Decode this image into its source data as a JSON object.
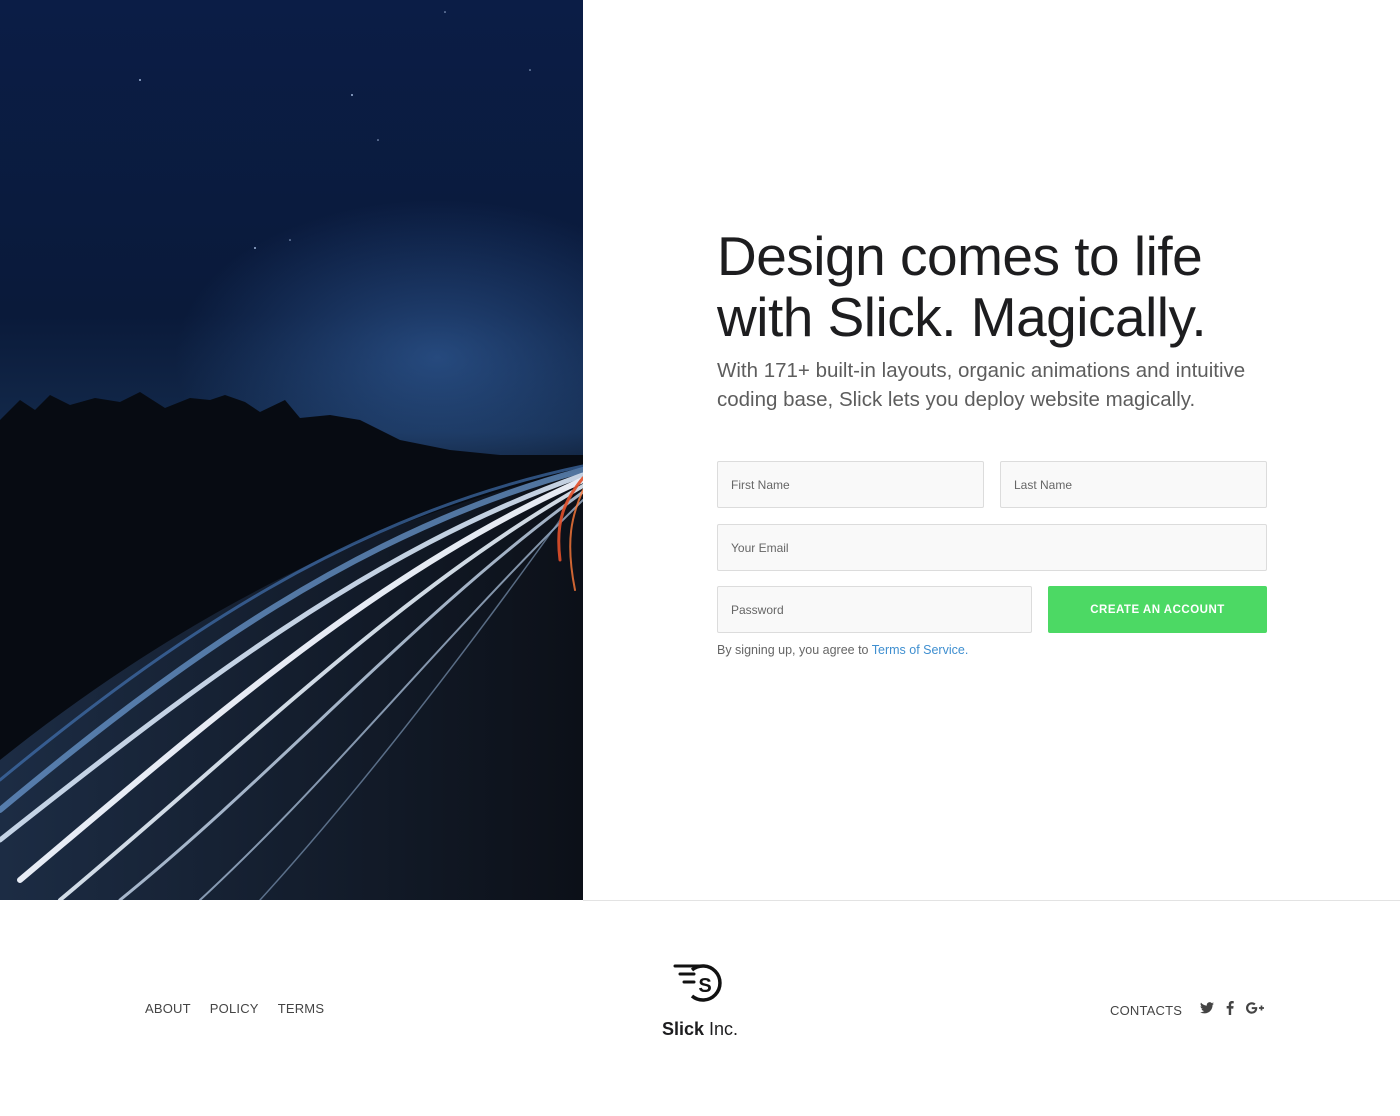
{
  "hero": {
    "headline_line1": "Design comes to life",
    "headline_line2": "with Slick. Magically.",
    "subtext": "With 171+ built-in layouts, organic animations and intuitive coding base, Slick lets you deploy website magically."
  },
  "form": {
    "first_name_placeholder": "First Name",
    "last_name_placeholder": "Last Name",
    "email_placeholder": "Your Email",
    "password_placeholder": "Password",
    "submit_label": "CREATE AN ACCOUNT",
    "terms_prefix": "By signing up, you agree to ",
    "terms_link": "Terms of Service."
  },
  "footer": {
    "nav_left": [
      "ABOUT",
      "POLICY",
      "TERMS"
    ],
    "brand_bold": "Slick",
    "brand_rest": " Inc.",
    "nav_right": "CONTACTS",
    "social_icons": [
      "twitter-icon",
      "facebook-icon",
      "google-plus-icon"
    ],
    "social_glyphs": [
      "🐦",
      "f",
      "G+"
    ]
  },
  "colors": {
    "accent_green": "#4cd964",
    "link_blue": "#3f8fd0",
    "photo_sky": "#0a1d40"
  }
}
